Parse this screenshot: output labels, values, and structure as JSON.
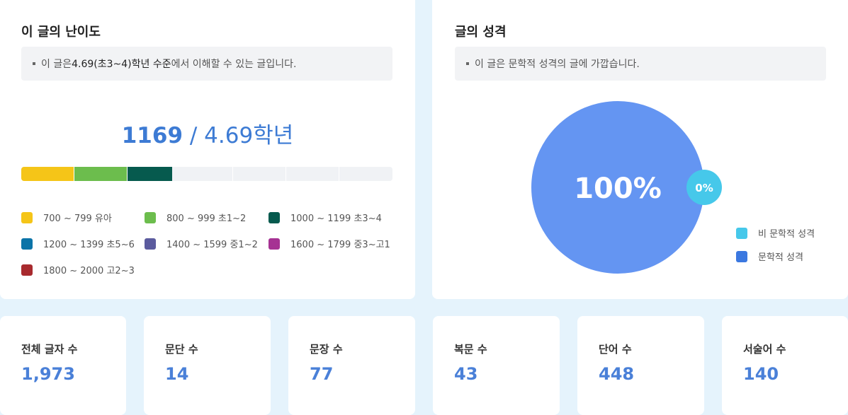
{
  "difficulty": {
    "title": "이 글의 난이도",
    "note_prefix": "이 글은 ",
    "note_level": "4.69(초3~4)학년 수준",
    "note_suffix": "에서 이해할 수 있는 글입니다.",
    "score": "1169",
    "separator": " / ",
    "grade": "4.69학년",
    "bar_fill_fraction": 0.405,
    "legend": [
      {
        "label": "700 ~ 799 유아",
        "color": "#f5c518"
      },
      {
        "label": "800 ~ 999 초1~2",
        "color": "#6cbd4d"
      },
      {
        "label": "1000 ~ 1199 초3~4",
        "color": "#065a4e"
      },
      {
        "label": "1200 ~ 1399 초5~6",
        "color": "#0b74a8"
      },
      {
        "label": "1400 ~ 1599 중1~2",
        "color": "#5b5b9e"
      },
      {
        "label": "1600 ~ 1799 중3~고1",
        "color": "#a63293"
      },
      {
        "label": "1800 ~ 2000 고2~3",
        "color": "#a82a2e"
      }
    ]
  },
  "nature": {
    "title": "글의 성격",
    "note": "이 글은 문학적 성격의 글에 가깝습니다.",
    "pie": {
      "main_label": "100%",
      "minor_label": "0%",
      "main_color": "#6495f2",
      "minor_color": "#46c8ea"
    },
    "legend": [
      {
        "label": "비 문학적 성격",
        "color": "#46c8ea"
      },
      {
        "label": "문학적 성격",
        "color": "#3b78e0"
      }
    ]
  },
  "stats": [
    {
      "label": "전체 글자 수",
      "value": "1,973"
    },
    {
      "label": "문단 수",
      "value": "14"
    },
    {
      "label": "문장 수",
      "value": "77"
    },
    {
      "label": "복문 수",
      "value": "43"
    },
    {
      "label": "단어 수",
      "value": "448"
    },
    {
      "label": "서술어 수",
      "value": "140"
    }
  ]
}
